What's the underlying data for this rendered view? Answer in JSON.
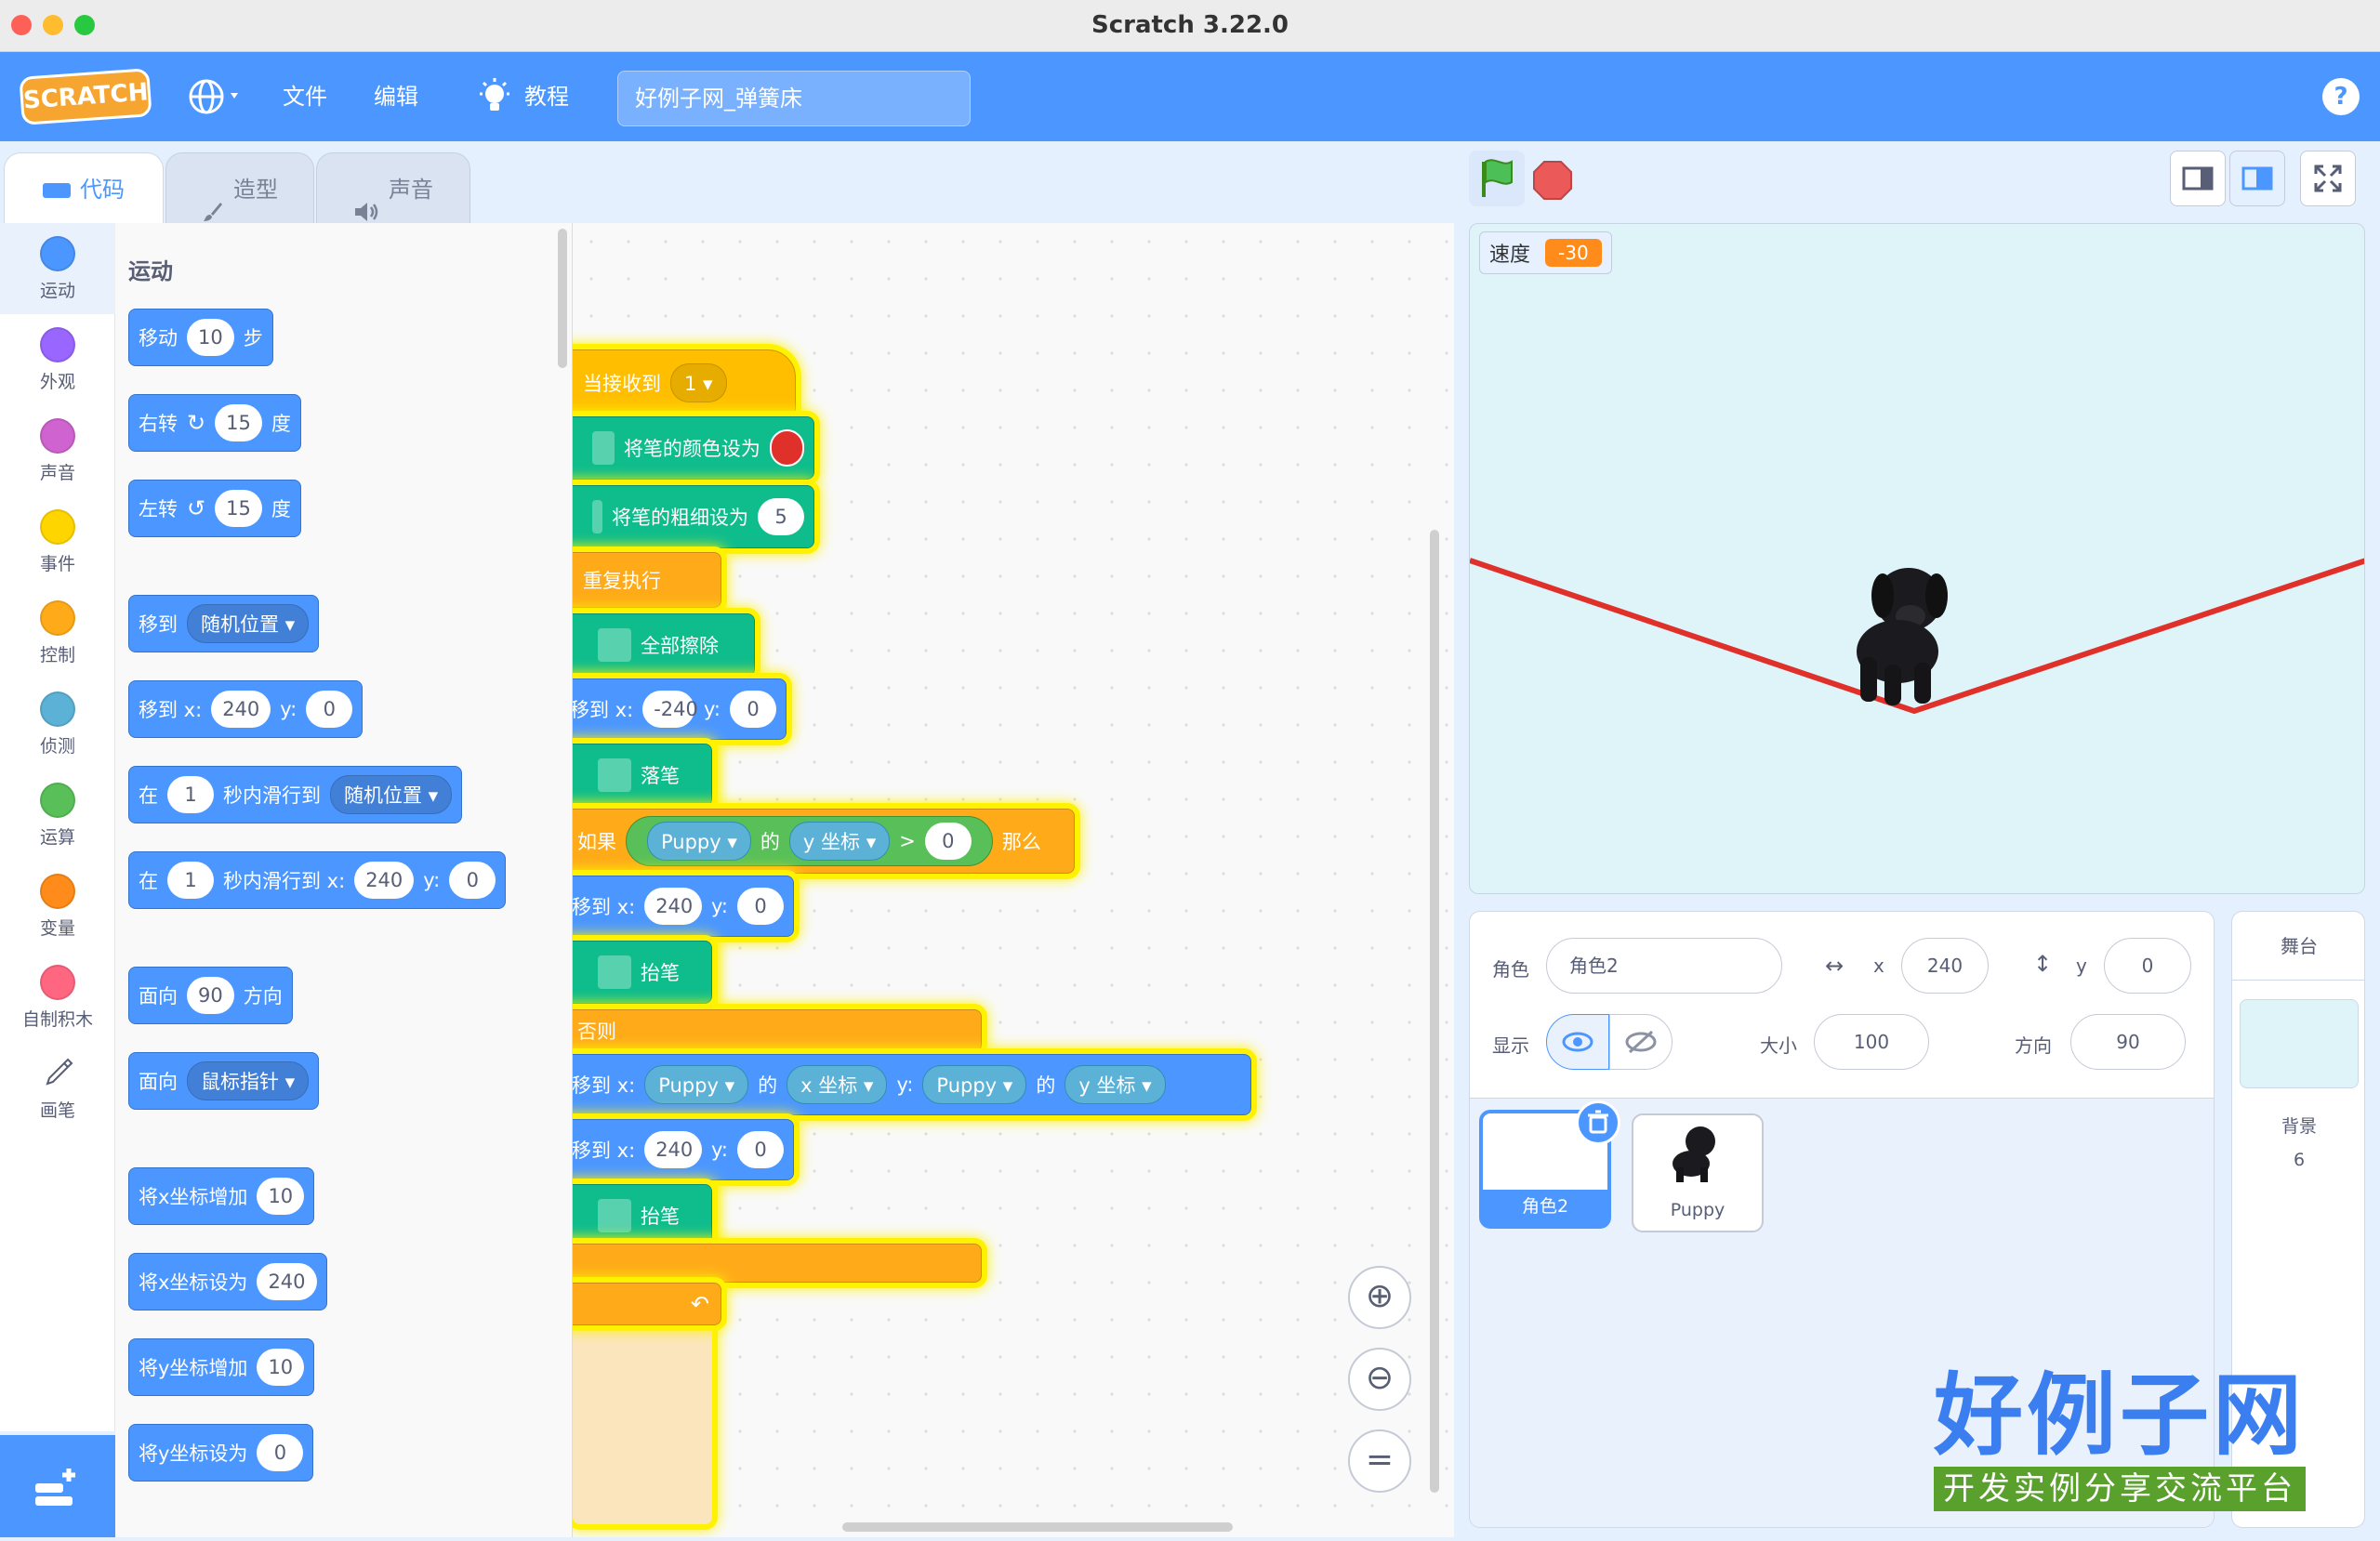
{
  "window": {
    "title": "Scratch 3.22.0"
  },
  "menubar": {
    "logo": "SCRATCH",
    "file": "文件",
    "edit": "编辑",
    "tutorials": "教程",
    "project_title": "好例子网_弹簧床",
    "help": "?"
  },
  "tabs": [
    {
      "label": "代码"
    },
    {
      "label": "造型"
    },
    {
      "label": "声音"
    }
  ],
  "categories": [
    {
      "label": "运动",
      "color": "#4c97ff"
    },
    {
      "label": "外观",
      "color": "#9966ff"
    },
    {
      "label": "声音",
      "color": "#cf63cf"
    },
    {
      "label": "事件",
      "color": "#ffd500"
    },
    {
      "label": "控制",
      "color": "#ffab19"
    },
    {
      "label": "侦测",
      "color": "#5cb1d6"
    },
    {
      "label": "运算",
      "color": "#59c059"
    },
    {
      "label": "变量",
      "color": "#ff8c1a"
    },
    {
      "label": "自制积木",
      "color": "#ff6680"
    },
    {
      "label": "画笔",
      "color": "#0fbd8c"
    }
  ],
  "palette": {
    "heading": "运动",
    "move": {
      "a": "移动",
      "n": "10",
      "b": "步"
    },
    "turn_right": {
      "a": "右转",
      "n": "15",
      "b": "度"
    },
    "turn_left": {
      "a": "左转",
      "n": "15",
      "b": "度"
    },
    "goto": {
      "a": "移到",
      "dd": "随机位置"
    },
    "goto_xy": {
      "a": "移到 x:",
      "x": "240",
      "b": "y:",
      "y": "0"
    },
    "glide_to": {
      "a": "在",
      "n": "1",
      "b": "秒内滑行到",
      "dd": "随机位置"
    },
    "glide_xy": {
      "a": "在",
      "n": "1",
      "b": "秒内滑行到 x:",
      "x": "240",
      "c": "y:",
      "y": "0"
    },
    "point_dir": {
      "a": "面向",
      "n": "90",
      "b": "方向"
    },
    "point_towards": {
      "a": "面向",
      "dd": "鼠标指针"
    },
    "change_x": {
      "a": "将x坐标增加",
      "n": "10"
    },
    "set_x": {
      "a": "将x坐标设为",
      "n": "240"
    },
    "change_y": {
      "a": "将y坐标增加",
      "n": "10"
    },
    "set_y": {
      "a": "将y坐标设为",
      "n": "0"
    }
  },
  "script": {
    "hat": {
      "a": "当接收到",
      "dd": "1"
    },
    "pen_color": "将笔的颜色设为",
    "pen_size": {
      "a": "将笔的粗细设为",
      "n": "5"
    },
    "forever": "重复执行",
    "clear": "全部擦除",
    "goto1": {
      "a": "移到 x:",
      "x": "-240",
      "b": "y:",
      "y": "0"
    },
    "pendown": "落笔",
    "if": {
      "a": "如果",
      "sprite": "Puppy",
      "of": "的",
      "prop": "y 坐标",
      "op": ">",
      "val": "0",
      "then": "那么"
    },
    "goto2": {
      "a": "移到 x:",
      "x": "240",
      "b": "y:",
      "y": "0"
    },
    "penup1": "抬笔",
    "else": "否则",
    "goto3": {
      "a": "移到 x:",
      "sprite1": "Puppy",
      "of1": "的",
      "prop1": "x 坐标",
      "b": "y:",
      "sprite2": "Puppy",
      "of2": "的",
      "prop2": "y 坐标"
    },
    "goto4": {
      "a": "移到 x:",
      "x": "240",
      "b": "y:",
      "y": "0"
    },
    "penup2": "抬笔"
  },
  "stage": {
    "monitor_label": "速度",
    "monitor_value": "-30",
    "pen_color": "#e0302a"
  },
  "sprite_info": {
    "sprite_label": "角色",
    "sprite_name": "角色2",
    "x_label": "x",
    "x": "240",
    "y_label": "y",
    "y": "0",
    "show_label": "显示",
    "size_label": "大小",
    "size": "100",
    "dir_label": "方向",
    "dir": "90"
  },
  "sprites": [
    {
      "name": "角色2",
      "selected": true
    },
    {
      "name": "Puppy",
      "selected": false
    }
  ],
  "stage_panel": {
    "title": "舞台",
    "backdrops_label": "背景",
    "backdrops_count": "6"
  },
  "watermark": {
    "title": "好例子网",
    "subtitle": "开发实例分享交流平台"
  }
}
